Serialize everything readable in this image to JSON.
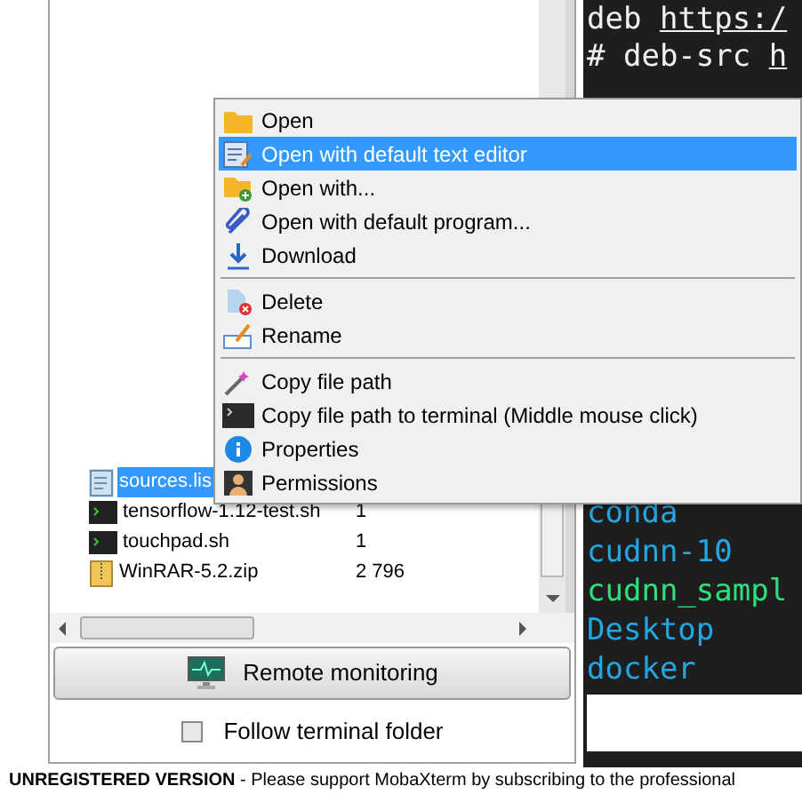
{
  "file_list": {
    "rows": [
      {
        "name": "sources.lis",
        "kind": "text",
        "selected": true
      },
      {
        "name": "tensorflow-1.12-test.sh",
        "size": "1",
        "kind": "shell",
        "selected": false
      },
      {
        "name": "touchpad.sh",
        "size": "1",
        "kind": "shell",
        "selected": false
      },
      {
        "name": "WinRAR-5.2.zip",
        "size": "2 796",
        "kind": "archive",
        "selected": false
      }
    ]
  },
  "remote_monitoring_button": {
    "label": "Remote monitoring"
  },
  "follow_terminal_folder": {
    "label": "Follow terminal folder",
    "checked": false
  },
  "context_menu": {
    "groups": [
      [
        {
          "label": "Open",
          "selected": false
        },
        {
          "label": "Open with default text editor",
          "selected": true
        },
        {
          "label": "Open with...",
          "selected": false
        },
        {
          "label": "Open with default program...",
          "selected": false
        },
        {
          "label": "Download",
          "selected": false
        }
      ],
      [
        {
          "label": "Delete",
          "selected": false
        },
        {
          "label": "Rename",
          "selected": false
        }
      ],
      [
        {
          "label": "Copy file path",
          "selected": false
        },
        {
          "label": "Copy file path to terminal (Middle mouse click)",
          "selected": false
        },
        {
          "label": "Properties",
          "selected": false
        },
        {
          "label": "Permissions",
          "selected": false
        }
      ]
    ]
  },
  "terminal": {
    "header_lines": [
      [
        {
          "text": "deb ",
          "underline": false
        },
        {
          "text": "https:/",
          "underline": true
        }
      ],
      [
        {
          "text": "# deb-src ",
          "underline": false
        },
        {
          "text": "h",
          "underline": true
        }
      ]
    ],
    "listing": [
      {
        "text": "conda",
        "color": "#26a6e0"
      },
      {
        "text": "cudnn-10",
        "color": "#26a6e0"
      },
      {
        "text": "cudnn_sampl",
        "color": "#2ee07c"
      },
      {
        "text": "Desktop",
        "color": "#26a6e0"
      },
      {
        "text": "docker",
        "color": "#26a6e0"
      }
    ]
  },
  "status_bar": {
    "text": "**UNREGISTERED VERSION**  -  Please support MobaXterm by subscribing to the professional"
  }
}
